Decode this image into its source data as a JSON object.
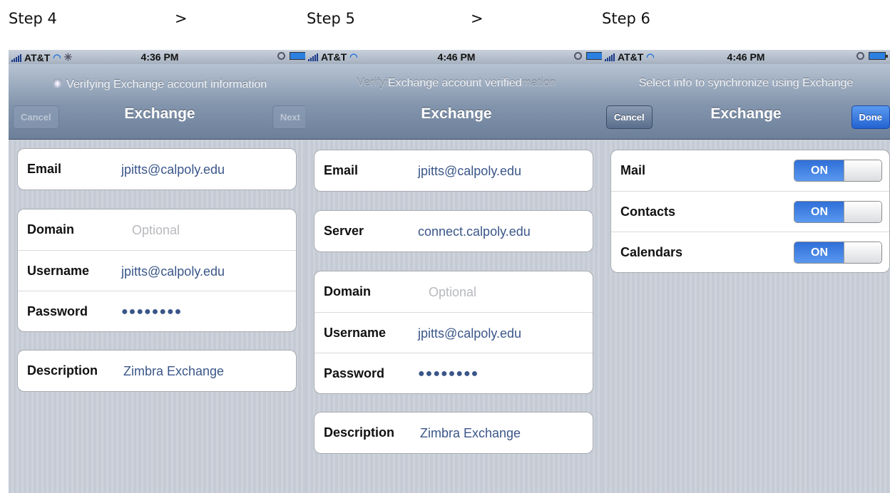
{
  "steps": {
    "step1": "Step 4",
    "arrow1": ">",
    "step2": "Step 5",
    "arrow2": ">",
    "step3": "Step 6"
  },
  "screen1": {
    "status": {
      "carrier": "AT&T",
      "time": "4:36 PM"
    },
    "prompt": "Verifying Exchange account information",
    "title": "Exchange",
    "cancel": "Cancel",
    "next": "Next",
    "email": {
      "label": "Email",
      "value": "jpitts@calpoly.edu"
    },
    "domain": {
      "label": "Domain",
      "placeholder": "Optional"
    },
    "username": {
      "label": "Username",
      "value": "jpitts@calpoly.edu"
    },
    "password": {
      "label": "Password",
      "value": "●●●●●●●●"
    },
    "description": {
      "label": "Description",
      "value": "Zimbra Exchange"
    }
  },
  "screen2": {
    "status": {
      "carrier": "AT&T",
      "time": "4:46 PM"
    },
    "prompt_faded_left": "Verifyi",
    "prompt": "Exchange account verified",
    "prompt_faded_right": "mation",
    "title": "Exchange",
    "email": {
      "label": "Email",
      "value": "jpitts@calpoly.edu"
    },
    "server": {
      "label": "Server",
      "value": "connect.calpoly.edu"
    },
    "domain": {
      "label": "Domain",
      "placeholder": "Optional"
    },
    "username": {
      "label": "Username",
      "value": "jpitts@calpoly.edu"
    },
    "password": {
      "label": "Password",
      "value": "●●●●●●●●"
    },
    "description": {
      "label": "Description",
      "value": "Zimbra Exchange"
    }
  },
  "screen3": {
    "status": {
      "carrier": "AT&T",
      "time": "4:46 PM"
    },
    "prompt": "Select info to synchronize using Exchange",
    "title": "Exchange",
    "cancel": "Cancel",
    "done": "Done",
    "toggles": [
      {
        "label": "Mail",
        "state": "ON"
      },
      {
        "label": "Contacts",
        "state": "ON"
      },
      {
        "label": "Calendars",
        "state": "ON"
      }
    ]
  },
  "icons": [
    "signal-bars-icon",
    "wifi-icon",
    "activity-spinner-icon",
    "lock-icon",
    "battery-icon"
  ],
  "colors": {
    "field_value": "#3a5689",
    "toggle_on": "#2f6fd8",
    "done_button": "#2462d1"
  }
}
